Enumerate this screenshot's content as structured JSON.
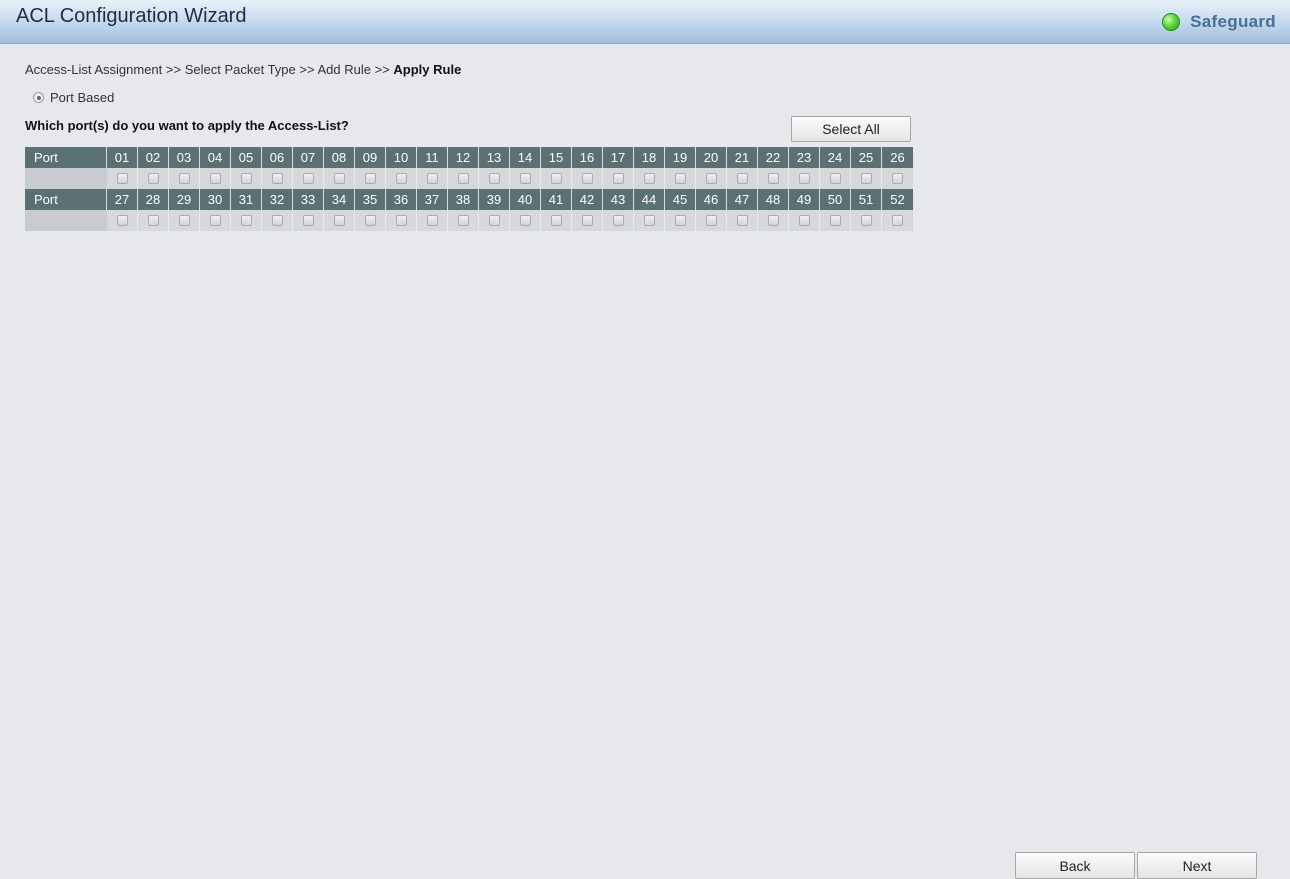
{
  "header": {
    "title": "ACL Configuration Wizard",
    "status_label": "Safeguard",
    "status_color": "#3cb81e"
  },
  "breadcrumb": {
    "step1": "Access-List Assignment",
    "sep": ">>",
    "step2": "Select Packet Type",
    "step3": "Add Rule",
    "current": "Apply Rule"
  },
  "mode": {
    "label": "Port Based",
    "selected": true
  },
  "question": "Which port(s) do you want to apply the Access-List?",
  "buttons": {
    "select_all": "Select All",
    "back": "Back",
    "next": "Next"
  },
  "ports": {
    "row_label": "Port",
    "rows": [
      [
        "01",
        "02",
        "03",
        "04",
        "05",
        "06",
        "07",
        "08",
        "09",
        "10",
        "11",
        "12",
        "13",
        "14",
        "15",
        "16",
        "17",
        "18",
        "19",
        "20",
        "21",
        "22",
        "23",
        "24",
        "25",
        "26"
      ],
      [
        "27",
        "28",
        "29",
        "30",
        "31",
        "32",
        "33",
        "34",
        "35",
        "36",
        "37",
        "38",
        "39",
        "40",
        "41",
        "42",
        "43",
        "44",
        "45",
        "46",
        "47",
        "48",
        "49",
        "50",
        "51",
        "52"
      ]
    ],
    "checked": []
  }
}
